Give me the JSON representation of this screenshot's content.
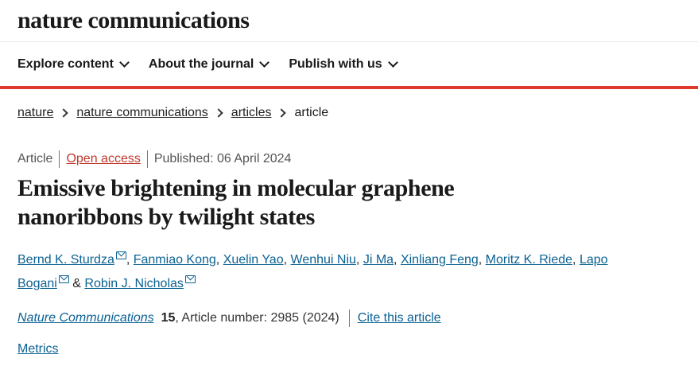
{
  "header": {
    "logo": "nature communications"
  },
  "nav": {
    "items": [
      {
        "label": "Explore content"
      },
      {
        "label": "About the journal"
      },
      {
        "label": "Publish with us"
      }
    ]
  },
  "breadcrumb": [
    "nature",
    "nature communications",
    "articles",
    "article"
  ],
  "article_meta": {
    "type": "Article",
    "access": "Open access",
    "published": "Published: 06 April 2024"
  },
  "title": "Emissive brightening in molecular graphene nanoribbons by twilight states",
  "authors": [
    "Bernd K. Sturdza",
    "Fanmiao Kong",
    "Xuelin Yao",
    "Wenhui Niu",
    "Ji Ma",
    "Xinliang Feng",
    "Moritz K. Riede",
    "Lapo Bogani",
    "Robin J. Nicholas"
  ],
  "separators": {
    "comma": ", ",
    "and": " & "
  },
  "citation": {
    "journal": "Nature Communications",
    "volume": "15",
    "article_number": ", Article number: 2985 (2024)",
    "cite_link": "Cite this article"
  },
  "metrics_link": "Metrics",
  "colors": {
    "brand_red": "#e0382b",
    "link_blue": "#0c6293",
    "open_access": "#c0392b"
  }
}
